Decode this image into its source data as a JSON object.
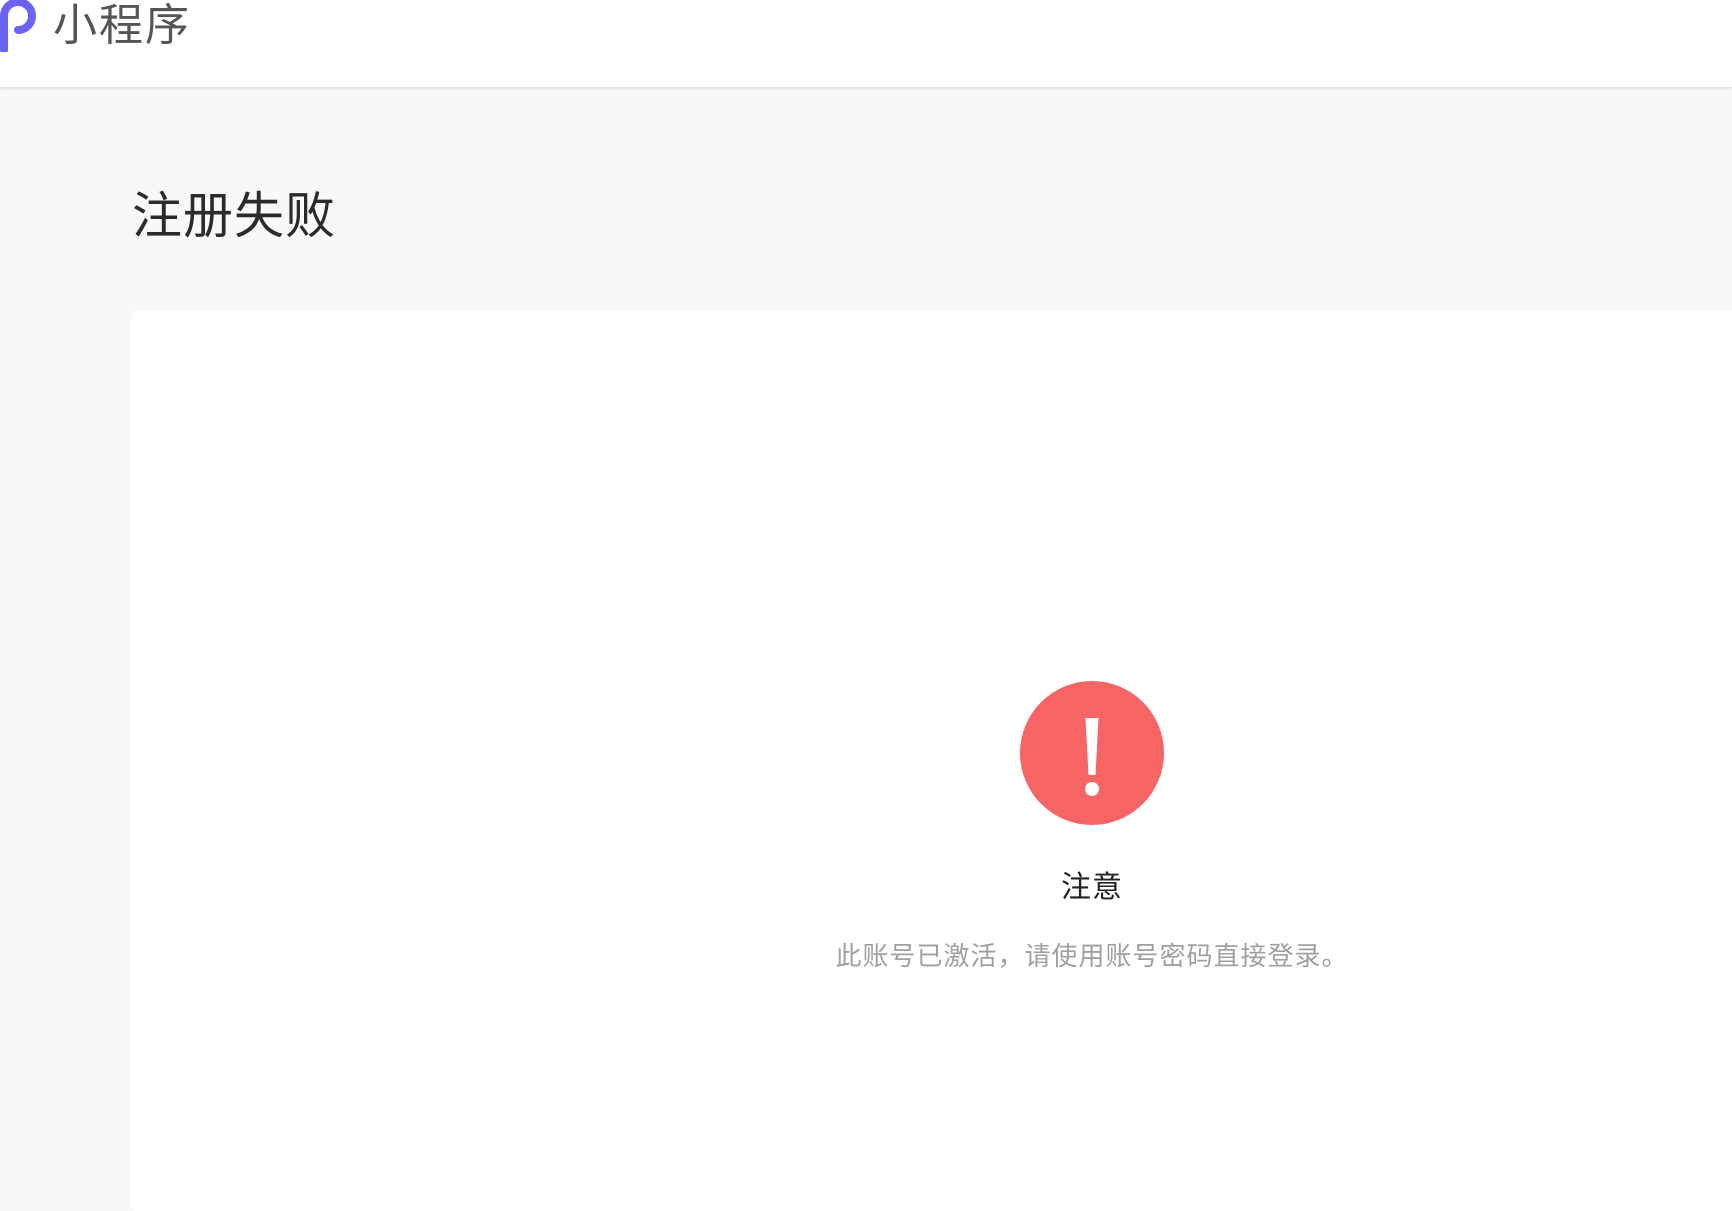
{
  "header": {
    "app_name": "小程序",
    "logo_icon": "logo-p-icon",
    "logo_color": "#6b63f6"
  },
  "page": {
    "title": "注册失败"
  },
  "result": {
    "icon": "exclamation-circle-icon",
    "icon_color": "#f76464",
    "title": "注意",
    "description": "此账号已激活，请使用账号密码直接登录。"
  }
}
